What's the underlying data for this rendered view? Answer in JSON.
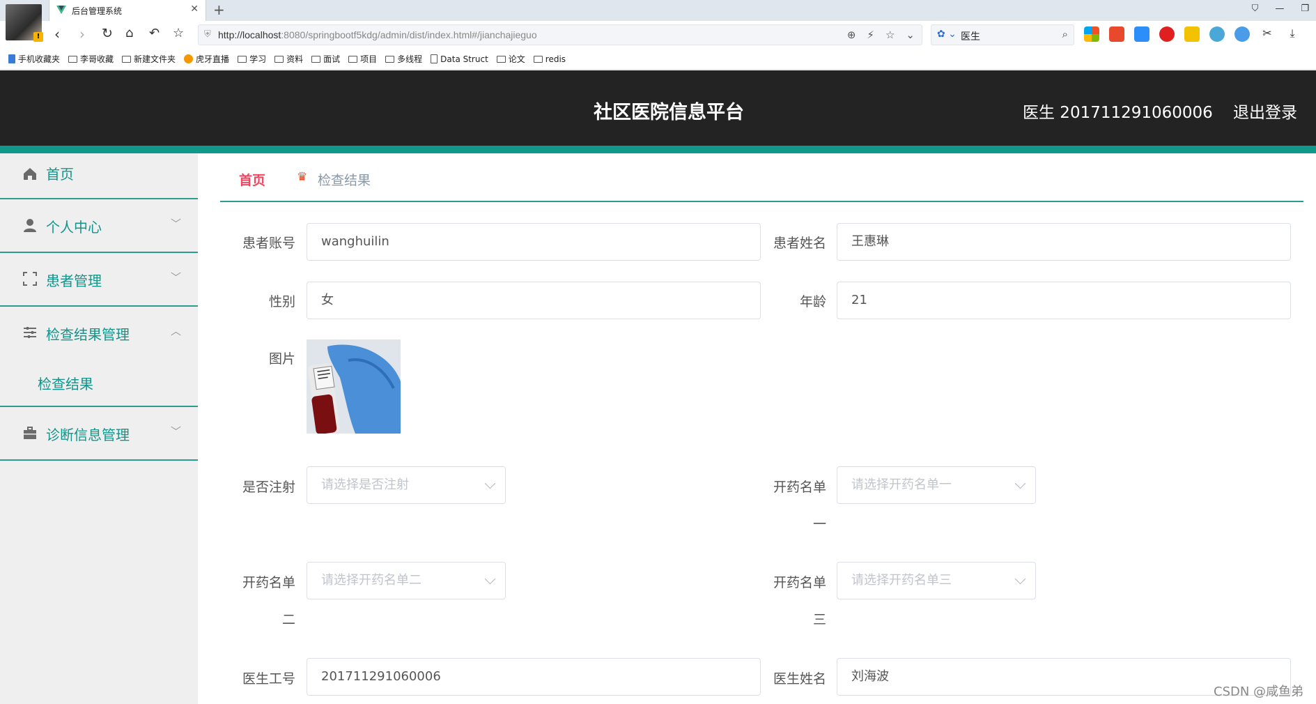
{
  "browser": {
    "tab_title": "后台管理系统",
    "url_host": "http://localhost",
    "url_rest": ":8080/springbootf5kdg/admin/dist/index.html#/jianchajieguo",
    "search_text": "医生",
    "bookmarks": [
      "手机收藏夹",
      "李哥收藏",
      "新建文件夹",
      "虎牙直播",
      "学习",
      "资料",
      "面试",
      "项目",
      "多线程",
      "Data Struct",
      "论文",
      "redis"
    ]
  },
  "header": {
    "title": "社区医院信息平台",
    "user": "医生 201711291060006",
    "logout": "退出登录"
  },
  "sidebar": {
    "items": [
      {
        "label": "首页"
      },
      {
        "label": "个人中心"
      },
      {
        "label": "患者管理"
      },
      {
        "label": "检查结果管理"
      },
      {
        "label": "诊断信息管理"
      }
    ],
    "sub_item": "检查结果"
  },
  "breadcrumb": {
    "home": "首页",
    "current": "检查结果"
  },
  "form": {
    "patient_account_label": "患者账号",
    "patient_account_value": "wanghuilin",
    "patient_name_label": "患者姓名",
    "patient_name_value": "王惠琳",
    "gender_label": "性别",
    "gender_value": "女",
    "age_label": "年龄",
    "age_value": "21",
    "image_label": "图片",
    "injection_label": "是否注射",
    "injection_placeholder": "请选择是否注射",
    "rx1_label_a": "开药名单",
    "rx1_label_b": "一",
    "rx1_placeholder": "请选择开药名单一",
    "rx2_label_a": "开药名单",
    "rx2_label_b": "二",
    "rx2_placeholder": "请选择开药名单二",
    "rx3_label_a": "开药名单",
    "rx3_label_b": "三",
    "rx3_placeholder": "请选择开药名单三",
    "doctor_id_label": "医生工号",
    "doctor_id_value": "201711291060006",
    "doctor_name_label": "医生姓名",
    "doctor_name_value": "刘海波"
  },
  "watermark": "CSDN @咸鱼弟",
  "colors": {
    "header_bg": "#232323",
    "accent": "#12958a",
    "breadcrumb_home": "#f4425f"
  }
}
